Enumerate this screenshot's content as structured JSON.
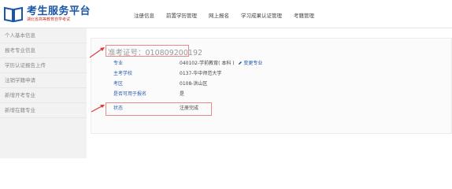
{
  "brand": {
    "title": "考生服务平台",
    "subtitle": "湖北省高等教育自学考试",
    "mark_color": "#1a56a8"
  },
  "nav": [
    "注册信息",
    "前置学历管理",
    "网上报名",
    "学习成果认证管理",
    "考籍管理"
  ],
  "sidebar": [
    "个人基本信息",
    "报考专业信息",
    "学历认证报告上传",
    "注销学籍申请",
    "新增开考专业",
    "新增在籍专业"
  ],
  "main": {
    "exam_no": "准考证号：010809200192",
    "rows": [
      {
        "label": "专业",
        "value": "040102-学前教育( 本科 )",
        "action": "变更专业"
      },
      {
        "label": "主考学校",
        "value": "0137-华中师范大学"
      },
      {
        "label": "考区",
        "value": "0108-洪山区"
      },
      {
        "label": "是否可用于报名",
        "value": "是"
      },
      {
        "label": "状态",
        "value": "注册完成"
      }
    ]
  },
  "colors": {
    "accent": "#1a56a8",
    "label": "#2a5db0",
    "annotation": "#e03c3c"
  }
}
